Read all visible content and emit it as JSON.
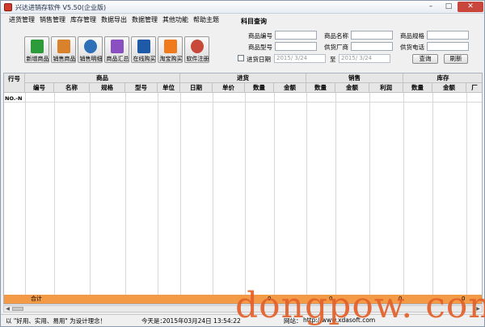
{
  "window": {
    "title": "兴达进销存软件 V5.50(企业版)",
    "controls": {
      "minimize": "–",
      "maximize": "□",
      "close": "✕"
    }
  },
  "menu": [
    "进货管理",
    "销售管理",
    "库存管理",
    "数据导出",
    "数据管理",
    "其他功能",
    "帮助主题"
  ],
  "toolbar": [
    {
      "label": "新增商品",
      "icon": "green-sheet-icon",
      "color": "#2e9b3a"
    },
    {
      "label": "销售商品",
      "icon": "boxes-icon",
      "color": "#d9822b"
    },
    {
      "label": "销售明细",
      "icon": "globe-icon",
      "color": "#2f6fb8"
    },
    {
      "label": "商品汇总",
      "icon": "cubes-icon",
      "color": "#8a4fc0"
    },
    {
      "label": "在线购买",
      "icon": "s-logo-icon",
      "color": "#1e5aa8"
    },
    {
      "label": "淘宝购买",
      "icon": "taobao-icon",
      "color": "#f07b1d"
    },
    {
      "label": "软件注册",
      "icon": "cd-icon",
      "color": "#c8483a"
    }
  ],
  "query": {
    "title": "科目查询",
    "fields": [
      {
        "label": "商品编号",
        "value": ""
      },
      {
        "label": "商品名称",
        "value": ""
      },
      {
        "label": "商品规格",
        "value": ""
      },
      {
        "label": "商品型号",
        "value": ""
      },
      {
        "label": "供货厂商",
        "value": ""
      },
      {
        "label": "供货电话",
        "value": ""
      }
    ],
    "date_checkbox_label": "进货日期",
    "date_from": "2015/ 3/24",
    "date_sep": "至",
    "date_to": "2015/ 3/24",
    "search_button": "查询",
    "refresh_button": "刷新"
  },
  "grid": {
    "row_header": "行号",
    "groups": [
      "商品",
      "进货",
      "销售",
      "库存"
    ],
    "columns": [
      "编号",
      "名称",
      "规格",
      "型号",
      "单位",
      "日期",
      "单价",
      "数量",
      "金额",
      "数量",
      "金额",
      "利润",
      "数量",
      "金额",
      "厂"
    ],
    "first_row_label": "NO.-N",
    "total_label": "合计",
    "totals": [
      "0",
      "0",
      "0",
      "0"
    ]
  },
  "status": {
    "slogan": "以 \"好用、实用、易用\" 为设计理念！",
    "today_label": "今天是：",
    "today_value": "2015年03月24日  13:54:22",
    "site_label": "网站：",
    "site_value": "http://www.xdasoft.com"
  },
  "watermark": "dongpow. com"
}
